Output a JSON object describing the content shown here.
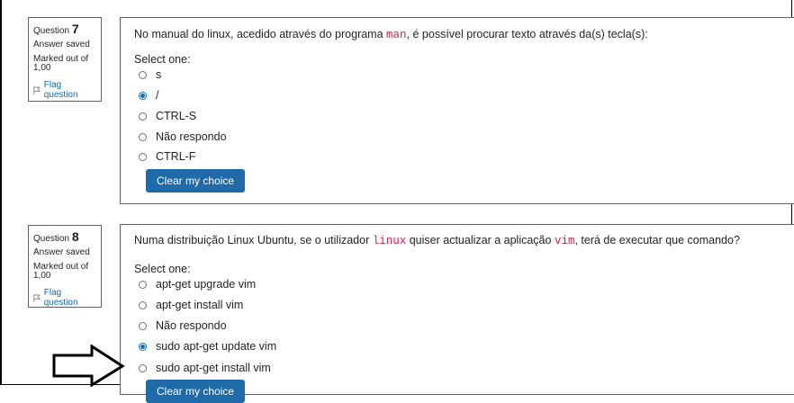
{
  "questions": [
    {
      "label": "Question",
      "number": "7",
      "state": "Answer saved",
      "grade_line1": "Marked out of",
      "grade_line2": "1,00",
      "flag": "Flag question",
      "text_parts": [
        "No manual do linux, acedido através do programa ",
        "man",
        ", é possível procurar texto através da(s) tecla(s):"
      ],
      "prompt": "Select one:",
      "options": [
        {
          "label": "s",
          "selected": false
        },
        {
          "label": "/",
          "selected": true
        },
        {
          "label": "CTRL-S",
          "selected": false
        },
        {
          "label": "Não respondo",
          "selected": false
        },
        {
          "label": "CTRL-F",
          "selected": false
        }
      ],
      "clear_label": "Clear my choice"
    },
    {
      "label": "Question",
      "number": "8",
      "state": "Answer saved",
      "grade_line1": "Marked out of",
      "grade_line2": "1,00",
      "flag": "Flag question",
      "text_parts": [
        "Numa distribuição Linux Ubuntu, se o utilizador ",
        "linux",
        " quiser actualizar a aplicação ",
        "vim",
        ", terá de executar que comando?"
      ],
      "prompt": "Select one:",
      "options": [
        {
          "label": "apt-get upgrade vim",
          "selected": false
        },
        {
          "label": "apt-get install vim",
          "selected": false
        },
        {
          "label": "Não respondo",
          "selected": false
        },
        {
          "label": "sudo apt-get update vim",
          "selected": true
        },
        {
          "label": "sudo apt-get install vim",
          "selected": false
        }
      ],
      "clear_label": "Clear my choice"
    }
  ],
  "colors": {
    "accent": "#0f6cbf",
    "button": "#1f6aa8",
    "code": "#c7254e"
  },
  "icons": {
    "flag": "flag-icon",
    "pointer": "arrow-right-icon"
  }
}
